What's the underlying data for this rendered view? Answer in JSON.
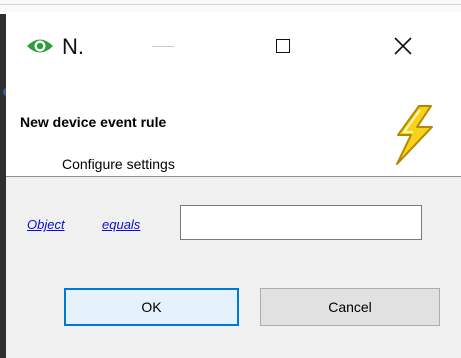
{
  "window": {
    "title": "N.",
    "icon": "eye-icon",
    "controls": {
      "minimize": "minimize-icon",
      "maximize": "maximize-icon",
      "close": "close-icon"
    }
  },
  "header": {
    "title": "New device event rule",
    "subtitle": "Configure settings",
    "icon": "lightning-bolt-icon"
  },
  "rule": {
    "field_link": "Object",
    "operator_link": "equals",
    "value": ""
  },
  "buttons": {
    "ok": "OK",
    "cancel": "Cancel"
  },
  "colors": {
    "link": "#0b0bd6",
    "accent": "#0078d7",
    "ok_fill": "#e5f1fb",
    "content_bg": "#f0f0f0",
    "icon_green": "#2e9e3b",
    "bolt_yellow": "#f5d21c"
  }
}
